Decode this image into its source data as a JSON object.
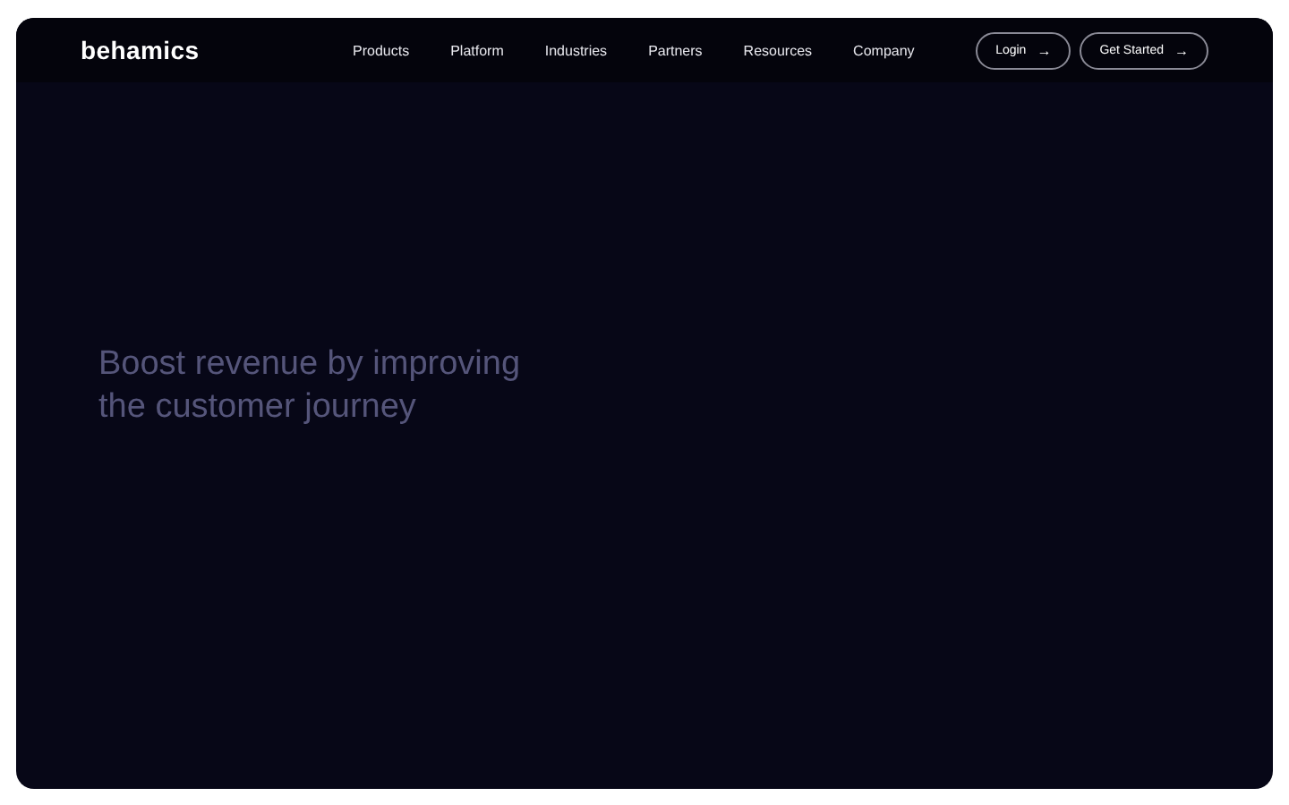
{
  "nav": {
    "logo": "behamics",
    "links": [
      "Products",
      "Platform",
      "Industries",
      "Partners",
      "Resources",
      "Company"
    ],
    "buttons": [
      {
        "label": "Login",
        "icon": "→"
      },
      {
        "label": "Get Started",
        "icon": "→"
      }
    ]
  },
  "hero": {
    "headline": "Boost revenue by improving the customer journey"
  }
}
